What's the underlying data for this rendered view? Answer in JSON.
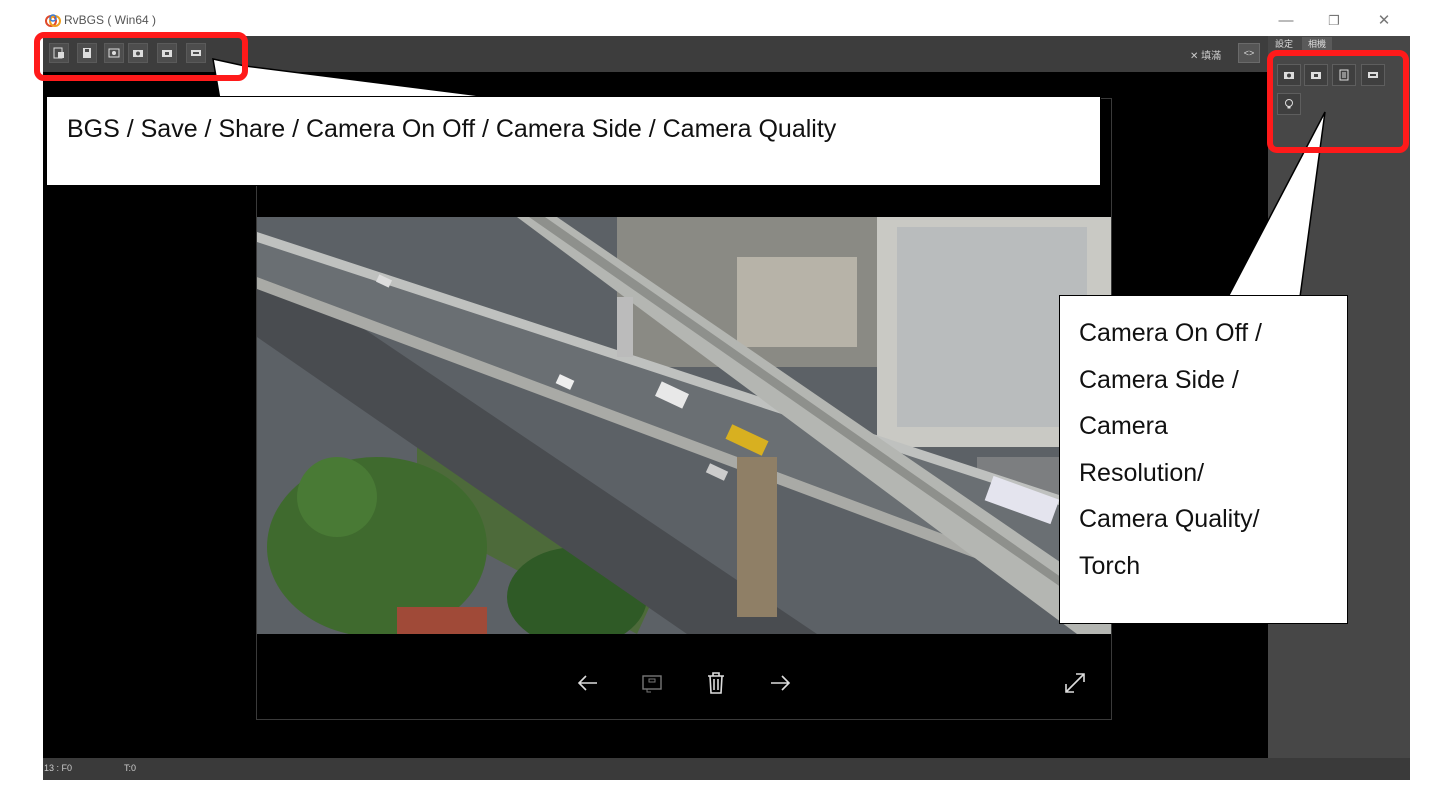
{
  "window": {
    "title": "RvBGS ( Win64 )",
    "controls": [
      "minimize-icon",
      "restore-icon",
      "close-icon"
    ]
  },
  "toolbar": {
    "buttons": [
      {
        "name": "bgs",
        "icon": "bgs-icon"
      },
      {
        "name": "save",
        "icon": "save-icon"
      },
      {
        "name": "share",
        "icon": "share-icon"
      },
      {
        "name": "camera-on-off",
        "icon": "camera-icon"
      },
      {
        "name": "camera-side",
        "icon": "camera-switch-icon"
      },
      {
        "name": "camera-quality",
        "icon": "quality-icon"
      }
    ],
    "filter_label": "✕ 填滿",
    "toggle_label": "<>"
  },
  "side_panel": {
    "tabs": [
      "設定",
      "相機"
    ],
    "buttons": [
      {
        "name": "camera-on-off",
        "icon": "camera-icon"
      },
      {
        "name": "camera-side",
        "icon": "camera-switch-icon"
      },
      {
        "name": "camera-resolution",
        "icon": "resolution-icon"
      },
      {
        "name": "camera-quality",
        "icon": "quality-icon"
      },
      {
        "name": "torch",
        "icon": "bulb-icon"
      }
    ]
  },
  "viewer": {
    "nav_icons": [
      "arrow-left-icon",
      "slideshow-icon",
      "trash-icon",
      "arrow-right-icon",
      "expand-icon"
    ]
  },
  "status_bar": {
    "left": "13 : F0",
    "middle": "T:0"
  },
  "annotations": {
    "top_callout": "BGS / Save / Share / Camera On Off / Camera Side / Camera Quality",
    "right_callout_lines": [
      "Camera On Off /",
      "Camera Side /",
      "Camera",
      "Resolution/",
      "Camera Quality/",
      "Torch"
    ],
    "highlight_color": "#ff1a1a"
  }
}
